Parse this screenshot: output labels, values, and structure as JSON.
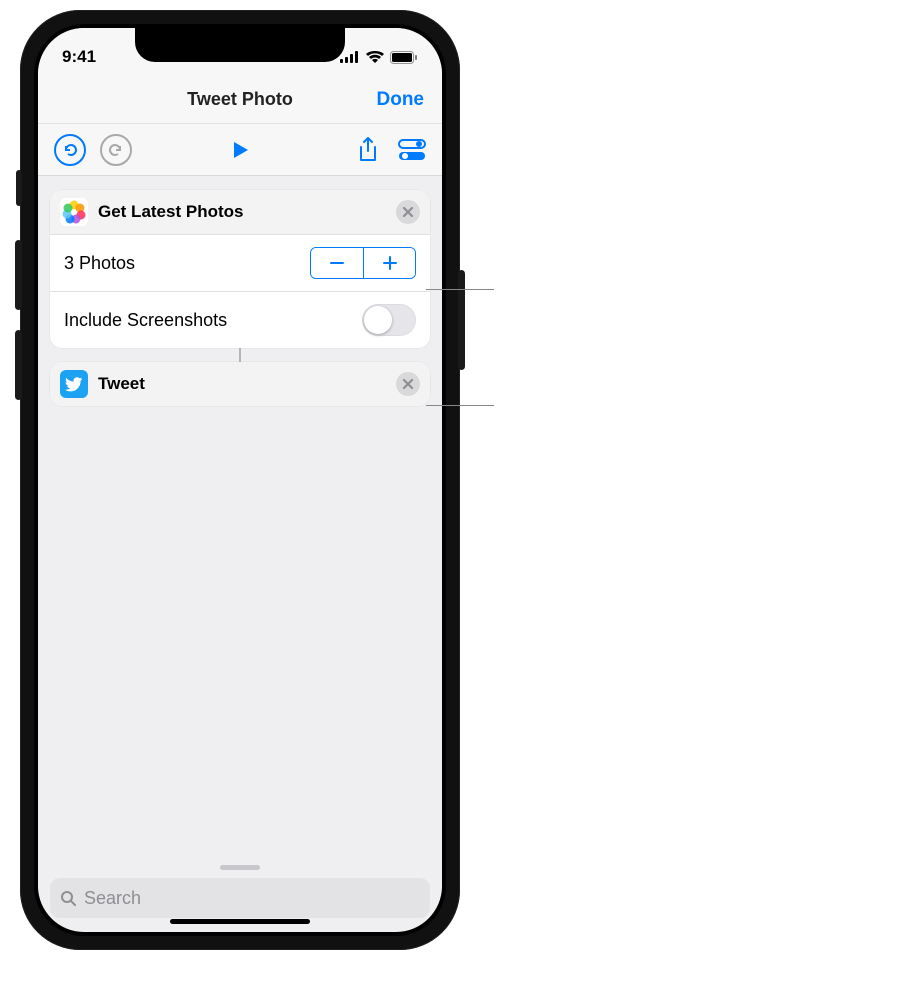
{
  "statusbar": {
    "time": "9:41"
  },
  "nav": {
    "title": "Tweet Photo",
    "done": "Done"
  },
  "actions": {
    "get_photos": {
      "title": "Get Latest Photos",
      "count_label": "3 Photos",
      "screenshots_label": "Include Screenshots",
      "screenshots_on": false
    },
    "tweet": {
      "title": "Tweet"
    }
  },
  "search": {
    "placeholder": "Search"
  },
  "icons": {
    "undo": "undo-icon",
    "redo": "redo-icon",
    "play": "play-icon",
    "share": "share-icon",
    "settings": "toggle-settings-icon",
    "photos": "photos-app-icon",
    "twitter": "twitter-bird-icon",
    "remove": "close-icon",
    "search": "magnifier-icon",
    "signal": "cellular-icon",
    "wifi": "wifi-icon",
    "battery": "battery-icon"
  }
}
